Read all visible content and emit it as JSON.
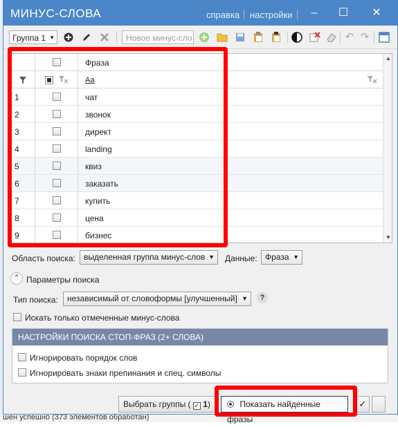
{
  "window": {
    "title": "МИНУС-СЛОВА",
    "links": [
      "справка",
      "настройки"
    ],
    "controls": {
      "minimize": "–",
      "maximize": "☐",
      "close": "✕"
    }
  },
  "toolbar": {
    "group_select": "Группа 1",
    "new_minus_placeholder": "Новое минус-сло"
  },
  "grid": {
    "header_phrase": "Фраза",
    "filter_text_icon": "Aa",
    "rows": [
      {
        "n": "1",
        "phrase": "чат"
      },
      {
        "n": "2",
        "phrase": "звонок"
      },
      {
        "n": "3",
        "phrase": "директ"
      },
      {
        "n": "4",
        "phrase": "landing"
      },
      {
        "n": "5",
        "phrase": "квиз"
      },
      {
        "n": "6",
        "phrase": "заказать"
      },
      {
        "n": "7",
        "phrase": "купить"
      },
      {
        "n": "8",
        "phrase": "цена"
      },
      {
        "n": "9",
        "phrase": "бизнес"
      }
    ]
  },
  "search": {
    "area_label": "Область поиска:",
    "area_value": "выделенная группа минус-слов",
    "data_label": "Данные:",
    "data_value": "Фраза",
    "params_label": "Параметры поиска",
    "type_label": "Тип поиска:",
    "type_value": "независимый от словоформы [улучшенный]",
    "help": "?",
    "only_checked_label": "Искать только отмеченные минус-слова"
  },
  "stop_phrases": {
    "header": "НАСТРОЙКИ ПОИСКА СТОП-ФРАЗ (2+ СЛОВА)",
    "ignore_order": "Игнорировать порядок слов",
    "ignore_punct": "Игнорировать знаки препинания и спец. символы"
  },
  "bottom": {
    "select_groups_label": "Выбрать группы (",
    "select_groups_count": "1",
    "select_groups_close": ")",
    "show_found_label": "Показать найденные фразы"
  },
  "status": "шен успешно (373 элементов обработан)"
}
